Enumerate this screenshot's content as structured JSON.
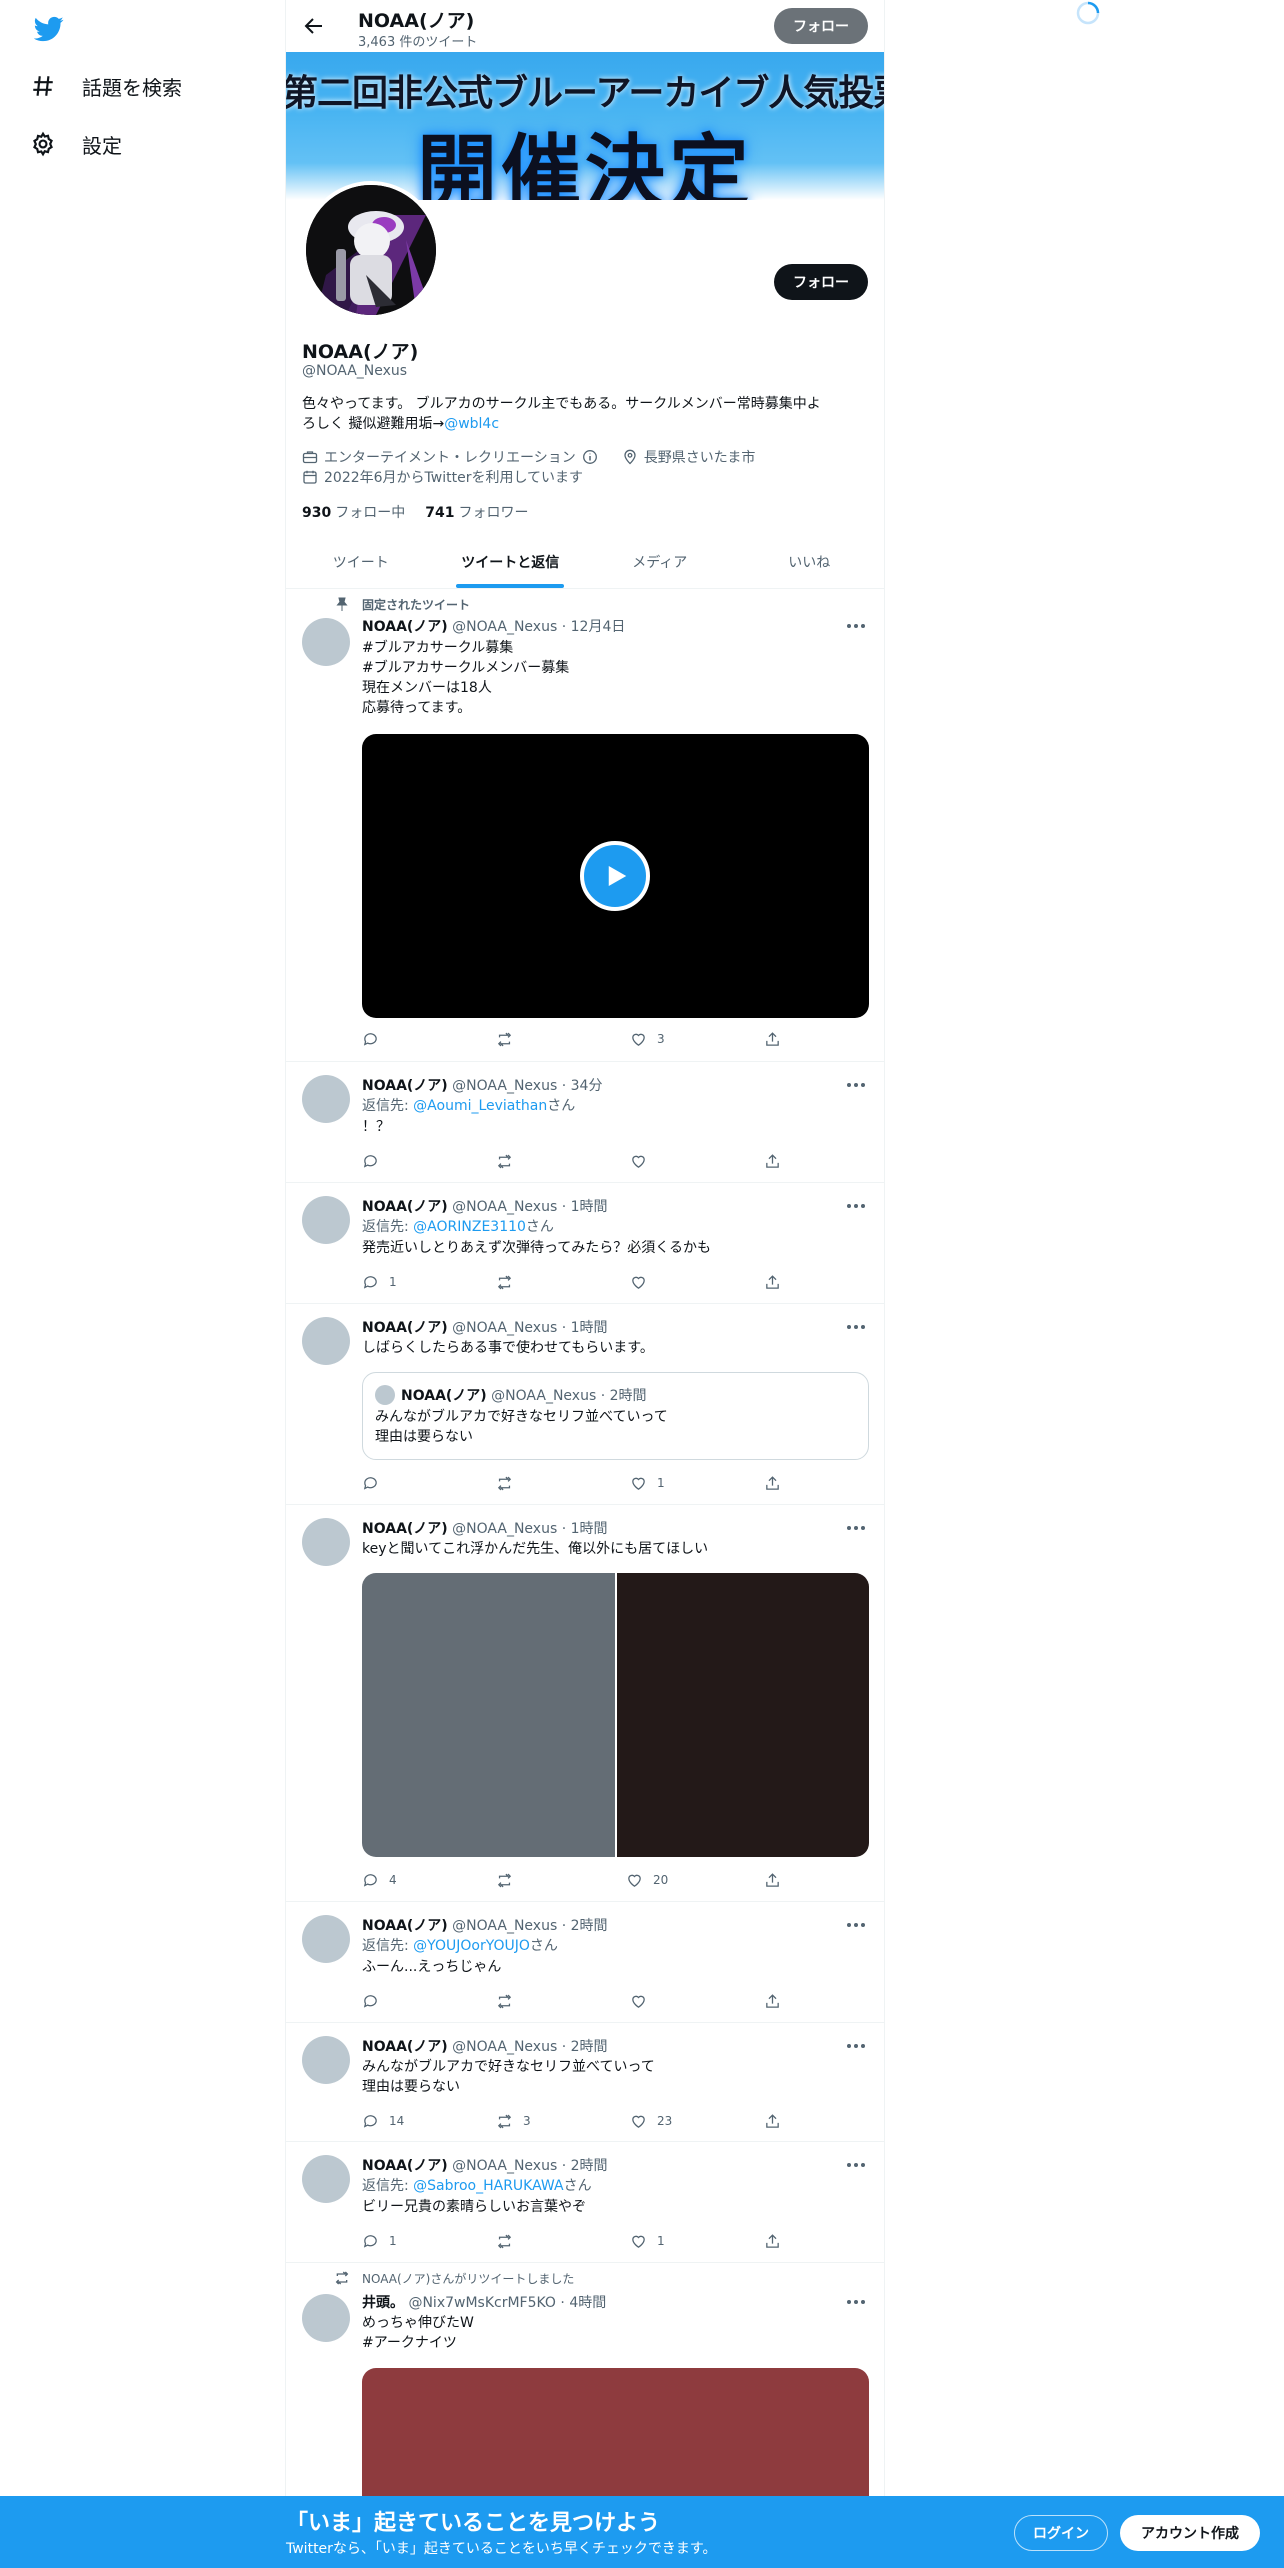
{
  "nav": {
    "logo_icon": "twitter-bird-icon",
    "explore_label": "話題を検索",
    "settings_label": "設定"
  },
  "header": {
    "name": "NOAA(ノア)",
    "tweet_count": "3,463 件のツイート",
    "follow_label": "フォロー"
  },
  "banner": {
    "line1": "第二回非公式ブルーアーカイブ人気投票",
    "line2": "開催決定"
  },
  "profile": {
    "follow_label": "フォロー",
    "name": "NOAA(ノア)",
    "handle": "@NOAA_Nexus",
    "bio_line1": "色々やってます。 ブルアカのサークル主でもある。サークルメンバー常時募集中よ",
    "bio_line2_text": "ろしく 擬似避難用垢→",
    "bio_link": "@wbl4c",
    "category": "エンターテイメント・レクリエーション",
    "location": "長野県さいたま市",
    "joined": "2022年6月からTwitterを利用しています",
    "following_count": "930",
    "following_label": "フォロー中",
    "followers_count": "741",
    "followers_label": "フォロワー"
  },
  "tabs": [
    "ツイート",
    "ツイートと返信",
    "メディア",
    "いいね"
  ],
  "active_tab": "ツイートと返信",
  "tweets": [
    {
      "context": "固定されたツイート",
      "name": "NOAA(ノア)",
      "handle": "@NOAA_Nexus",
      "time": "12月4日",
      "hashtag1": "#ブルアカサークル募集",
      "hashtag2": "#ブルアカサークルメンバー募集",
      "text1": "現在メンバーは18人",
      "text2": "応募待ってます。",
      "likes": "3"
    },
    {
      "name": "NOAA(ノア)",
      "handle": "@NOAA_Nexus",
      "time": "34分",
      "reply_prefix": "返信先: ",
      "reply_to": "@Aoumi_Leviathan",
      "reply_suffix": "さん",
      "text1": "！？"
    },
    {
      "name": "NOAA(ノア)",
      "handle": "@NOAA_Nexus",
      "time": "1時間",
      "reply_prefix": "返信先: ",
      "reply_to": "@AORINZE3110",
      "reply_suffix": "さん",
      "text1": "発売近いしとりあえず次弾待ってみたら？必須くるかも",
      "replies": "1"
    },
    {
      "name": "NOAA(ノア)",
      "handle": "@NOAA_Nexus",
      "time": "1時間",
      "text1": "しばらくしたらある事で使わせてもらいます。",
      "quote_name": "NOAA(ノア)",
      "quote_handle": "@NOAA_Nexus",
      "quote_time": "2時間",
      "quote_text1": "みんながブルアカで好きなセリフ並べていって",
      "quote_text2": "理由は要らない",
      "likes": "1"
    },
    {
      "name": "NOAA(ノア)",
      "handle": "@NOAA_Nexus",
      "time": "1時間",
      "text1": "keyと聞いてこれ浮かんだ先生、俺以外にも居てほしい",
      "replies": "4",
      "likes": "20"
    },
    {
      "name": "NOAA(ノア)",
      "handle": "@NOAA_Nexus",
      "time": "2時間",
      "reply_prefix": "返信先: ",
      "reply_to": "@YOUJOorYOUJO",
      "reply_suffix": "さん",
      "text1": "ふーん...えっちじゃん"
    },
    {
      "name": "NOAA(ノア)",
      "handle": "@NOAA_Nexus",
      "time": "2時間",
      "text1": "みんながブルアカで好きなセリフ並べていって",
      "text2": "理由は要らない",
      "replies": "14",
      "retweets": "3",
      "likes": "23"
    },
    {
      "name": "NOAA(ノア)",
      "handle": "@NOAA_Nexus",
      "time": "2時間",
      "reply_prefix": "返信先: ",
      "reply_to": "@Sabroo_HARUKAWA",
      "reply_suffix": "さん",
      "text1": "ビリー兄貴の素晴らしいお言葉やぞ",
      "replies": "1",
      "likes": "1"
    },
    {
      "context": "NOAA(ノア)さんがリツイートしました",
      "name": "井頭。",
      "handle": "@Nix7wMsKcrMF5KO",
      "time": "4時間",
      "text1": "めっちゃ伸びたW",
      "hashtag1": "#アークナイツ"
    }
  ],
  "bottom_bar": {
    "title": "「いま」起きていることを見つけよう",
    "subtitle": "Twitterなら、「いま」起きていることをいち早くチェックできます。",
    "login_label": "ログイン",
    "signup_label": "アカウント作成"
  },
  "colors": {
    "accent": "#1d9bf0",
    "text": "#0f1419",
    "secondary": "#536471",
    "border": "#eff3f4"
  }
}
